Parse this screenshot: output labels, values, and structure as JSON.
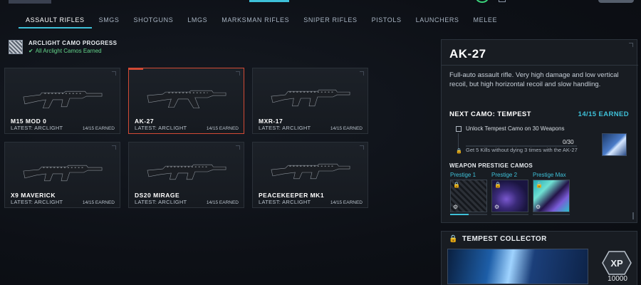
{
  "tabs": [
    {
      "label": "ASSAULT RIFLES",
      "active": true
    },
    {
      "label": "SMGS",
      "active": false
    },
    {
      "label": "SHOTGUNS",
      "active": false
    },
    {
      "label": "LMGS",
      "active": false
    },
    {
      "label": "MARKSMAN RIFLES",
      "active": false
    },
    {
      "label": "SNIPER RIFLES",
      "active": false
    },
    {
      "label": "PISTOLS",
      "active": false
    },
    {
      "label": "LAUNCHERS",
      "active": false
    },
    {
      "label": "MELEE",
      "active": false
    }
  ],
  "camo_progress": {
    "title": "ARCLIGHT CAMO PROGRESS",
    "status": "All Arclight Camos Earned",
    "status_icon": "check-icon"
  },
  "weapons": [
    {
      "name": "M15 MOD 0",
      "latest": "LATEST: ARCLIGHT",
      "earned": "14/15 EARNED",
      "selected": false
    },
    {
      "name": "AK-27",
      "latest": "LATEST: ARCLIGHT",
      "earned": "14/15 EARNED",
      "selected": true
    },
    {
      "name": "MXR-17",
      "latest": "LATEST: ARCLIGHT",
      "earned": "14/15 EARNED",
      "selected": false
    },
    {
      "name": "X9 MAVERICK",
      "latest": "LATEST: ARCLIGHT",
      "earned": "14/15 EARNED",
      "selected": false
    },
    {
      "name": "DS20 MIRAGE",
      "latest": "LATEST: ARCLIGHT",
      "earned": "14/15 EARNED",
      "selected": false
    },
    {
      "name": "PEACEKEEPER MK1",
      "latest": "LATEST: ARCLIGHT",
      "earned": "14/15 EARNED",
      "selected": false
    }
  ],
  "detail": {
    "weapon_name": "AK-27",
    "description": "Full-auto assault rifle. Very high damage and low vertical recoil, but high horizontal recoil and slow handling.",
    "next_camo_label": "NEXT CAMO: TEMPEST",
    "next_camo_count": "14/15 EARNED",
    "challenge": {
      "title": "Unlock Tempest Camo on 30 Weapons",
      "progress_text": "0/30",
      "progress": 0,
      "subtask": "Get 5 Kills without dying 3 times with the AK-27",
      "subtask_icon": "lock-icon"
    },
    "prestige_title": "WEAPON PRESTIGE CAMOS",
    "prestige_camos": [
      {
        "label": "Prestige 1",
        "icon": "lock-icon",
        "badge": "prestige-badge-icon",
        "progress": 0.5
      },
      {
        "label": "Prestige 2",
        "icon": "lock-icon",
        "badge": "prestige-badge-icon",
        "progress": 0
      },
      {
        "label": "Prestige Max",
        "icon": "lock-icon",
        "badge": "prestige-badge-icon",
        "progress": 0
      }
    ]
  },
  "collector": {
    "title": "TEMPEST COLLECTOR",
    "title_icon": "lock-icon",
    "xp_badge": "XP",
    "xp_value": "10000"
  },
  "colors": {
    "accent": "#3ec0d8",
    "selected_border": "#d24a35",
    "success": "#63d48a"
  }
}
